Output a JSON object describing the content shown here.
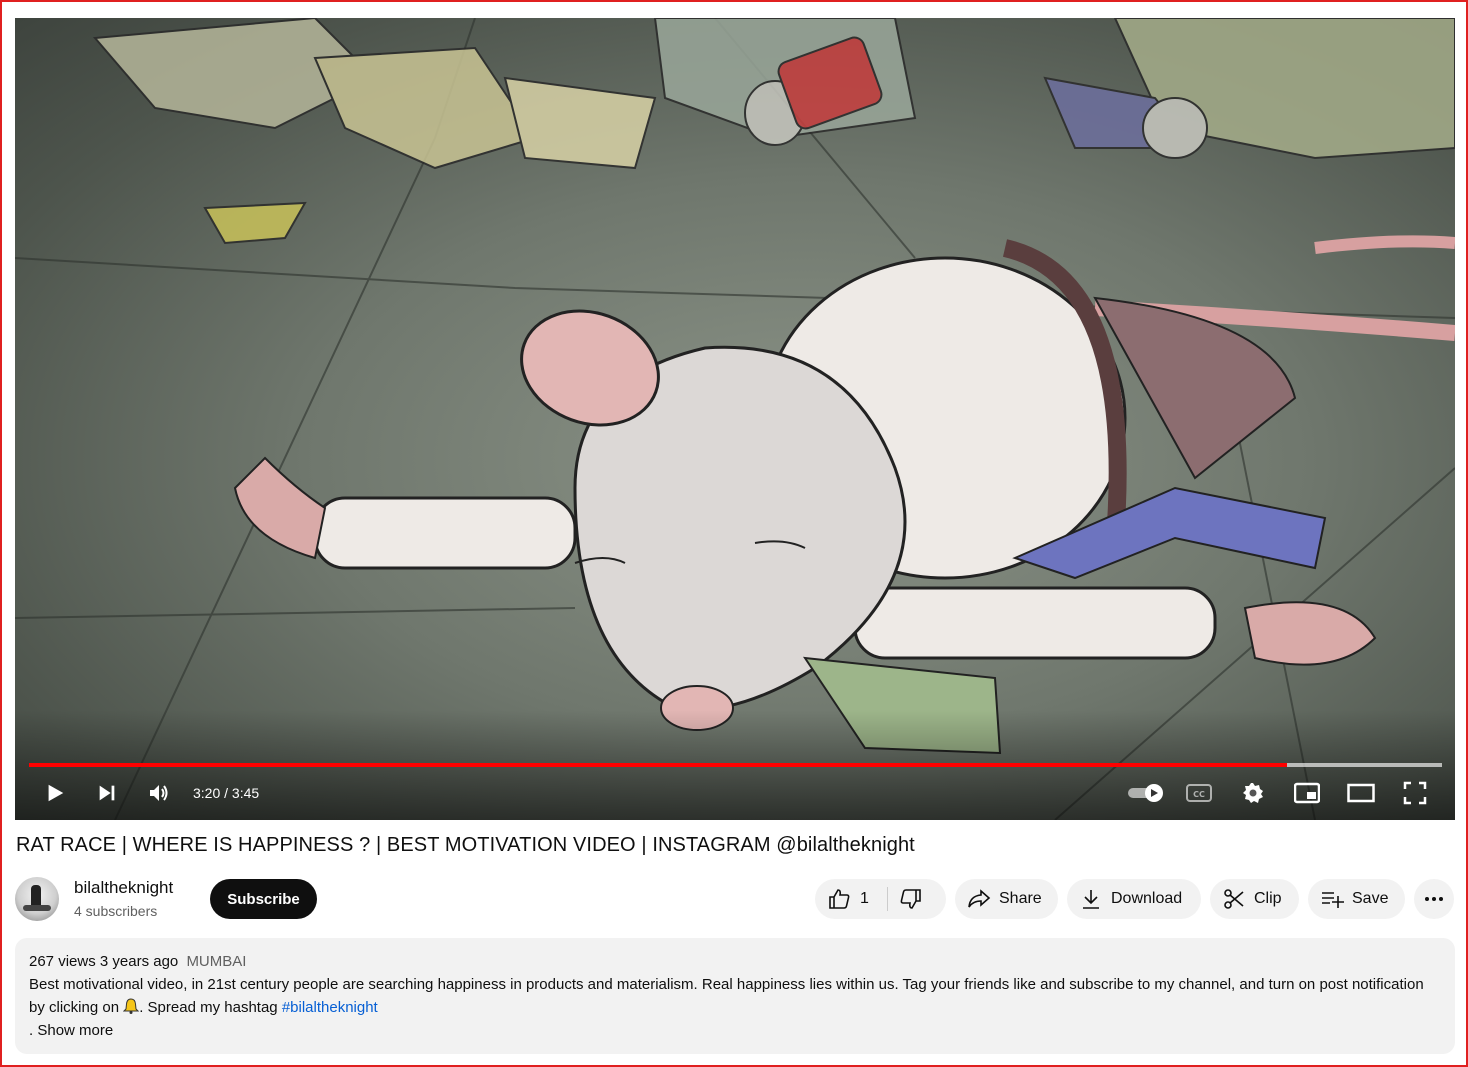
{
  "player": {
    "current_time": "3:20",
    "duration": "3:45",
    "time_separator": "/",
    "played_fraction": 0.89,
    "loaded_fraction": 1.0,
    "accent_color": "#ff0000"
  },
  "video": {
    "title": "RAT RACE | WHERE IS HAPPINESS ? | BEST MOTIVATION VIDEO | INSTAGRAM @bilaltheknight"
  },
  "channel": {
    "name": "bilaltheknight",
    "subscribers": "4 subscribers",
    "subscribe_label": "Subscribe"
  },
  "actions": {
    "like_count": "1",
    "share_label": "Share",
    "download_label": "Download",
    "clip_label": "Clip",
    "save_label": "Save"
  },
  "description": {
    "views": "267 views",
    "age": "3 years ago",
    "location_tag": "MUMBAI",
    "text_before_bell": "Best motivational video, in 21st century people are searching happiness in products and materialism. Real happiness lies within us. Tag your friends like and subscribe to my channel, and turn on post notification by clicking on",
    "text_after_bell": ". Spread my hashtag",
    "hashtag": "#bilaltheknight",
    "ellipsis_prefix": ".",
    "show_more": "Show more"
  },
  "icons": [
    "play-icon",
    "next-icon",
    "volume-icon",
    "autoplay-toggle-icon",
    "captions-icon",
    "settings-icon",
    "miniplayer-icon",
    "theater-icon",
    "fullscreen-icon",
    "like-icon",
    "dislike-icon",
    "share-icon",
    "download-icon",
    "clip-icon",
    "save-icon",
    "more-icon",
    "bell-icon"
  ]
}
